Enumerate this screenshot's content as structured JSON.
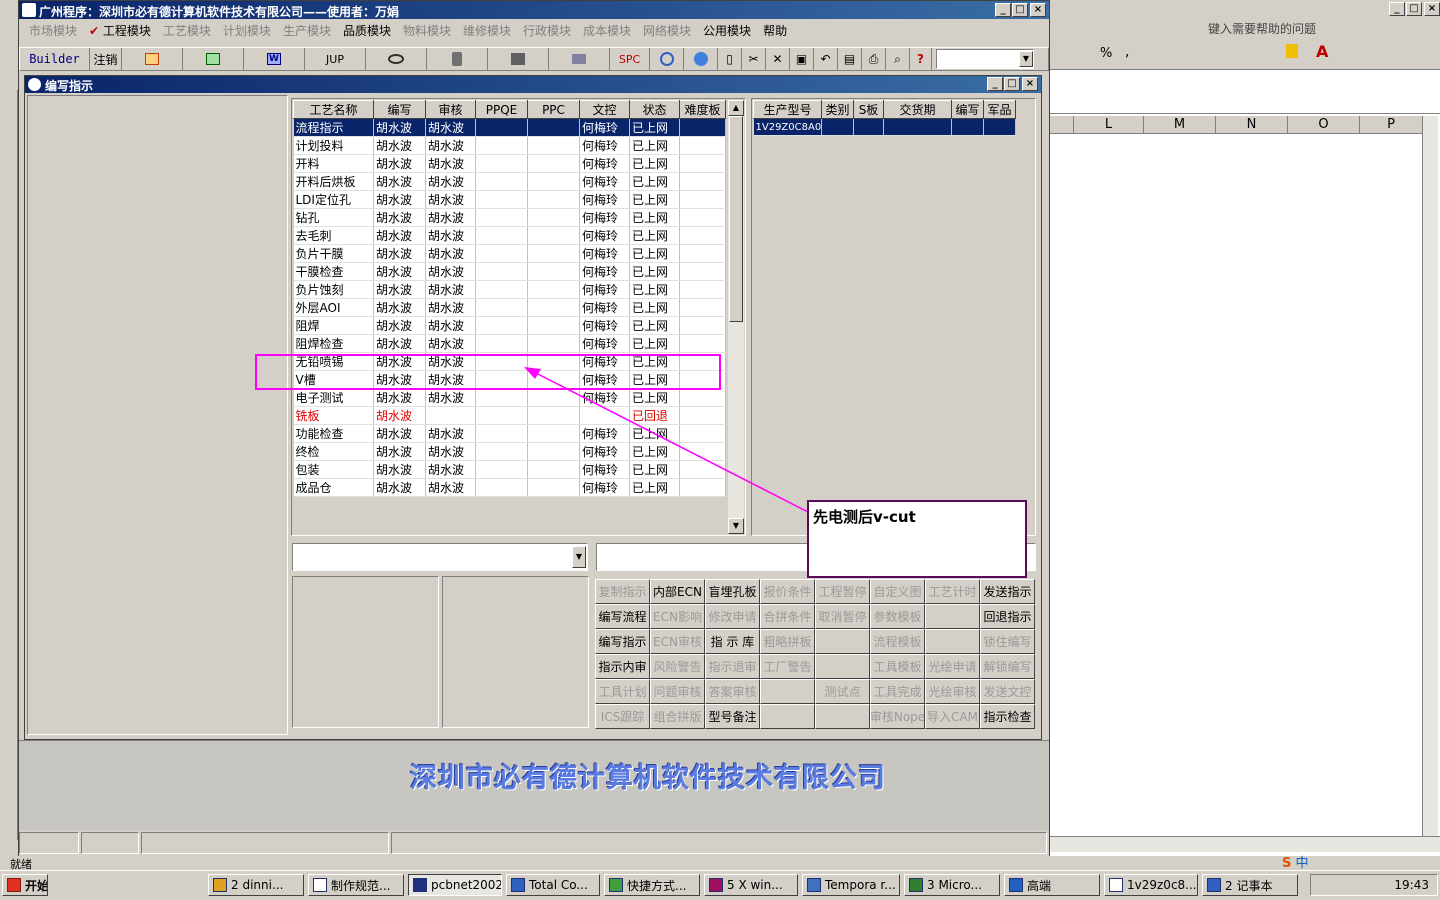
{
  "excel": {
    "help_placeholder": "键入需要帮助的问题",
    "columns": [
      "L",
      "M",
      "N",
      "O",
      "P"
    ]
  },
  "app": {
    "title": "广州程序：深圳市必有德计算机软件技术有限公司——使用者：万娟",
    "menu": [
      {
        "label": "市场模块",
        "enabled": false
      },
      {
        "label": "工程模块",
        "enabled": true,
        "checked": true
      },
      {
        "label": "工艺模块",
        "enabled": false
      },
      {
        "label": "计划模块",
        "enabled": false
      },
      {
        "label": "生产模块",
        "enabled": false
      },
      {
        "label": "品质模块",
        "enabled": true
      },
      {
        "label": "物料模块",
        "enabled": false
      },
      {
        "label": "维修模块",
        "enabled": false
      },
      {
        "label": "行政模块",
        "enabled": false
      },
      {
        "label": "成本模块",
        "enabled": false
      },
      {
        "label": "网络模块",
        "enabled": false
      },
      {
        "label": "公用模块",
        "enabled": true
      },
      {
        "label": "帮助",
        "enabled": true
      }
    ],
    "toolbar": {
      "builder": "Builder",
      "logout": "注销",
      "jup": "JUP",
      "spc": "SPC"
    },
    "company_banner": "深圳市必有德计算机软件技术有限公司",
    "status_ready": "就绪"
  },
  "inner_window": {
    "title": "编写指示",
    "process_grid": {
      "headers": [
        "工艺名称",
        "编写",
        "审核",
        "PPQE",
        "PPC",
        "文控",
        "状态",
        "难度板"
      ],
      "rows": [
        [
          "流程指示",
          "胡水波",
          "胡水波",
          "",
          "",
          "何梅玲",
          "已上网",
          ""
        ],
        [
          "计划投料",
          "胡水波",
          "胡水波",
          "",
          "",
          "何梅玲",
          "已上网",
          ""
        ],
        [
          "开料",
          "胡水波",
          "胡水波",
          "",
          "",
          "何梅玲",
          "已上网",
          ""
        ],
        [
          "开料后烘板",
          "胡水波",
          "胡水波",
          "",
          "",
          "何梅玲",
          "已上网",
          ""
        ],
        [
          "LDI定位孔",
          "胡水波",
          "胡水波",
          "",
          "",
          "何梅玲",
          "已上网",
          ""
        ],
        [
          "钻孔",
          "胡水波",
          "胡水波",
          "",
          "",
          "何梅玲",
          "已上网",
          ""
        ],
        [
          "去毛刺",
          "胡水波",
          "胡水波",
          "",
          "",
          "何梅玲",
          "已上网",
          ""
        ],
        [
          "负片干膜",
          "胡水波",
          "胡水波",
          "",
          "",
          "何梅玲",
          "已上网",
          ""
        ],
        [
          "干膜检查",
          "胡水波",
          "胡水波",
          "",
          "",
          "何梅玲",
          "已上网",
          ""
        ],
        [
          "负片蚀刻",
          "胡水波",
          "胡水波",
          "",
          "",
          "何梅玲",
          "已上网",
          ""
        ],
        [
          "外层AOI",
          "胡水波",
          "胡水波",
          "",
          "",
          "何梅玲",
          "已上网",
          ""
        ],
        [
          "阻焊",
          "胡水波",
          "胡水波",
          "",
          "",
          "何梅玲",
          "已上网",
          ""
        ],
        [
          "阻焊检查",
          "胡水波",
          "胡水波",
          "",
          "",
          "何梅玲",
          "已上网",
          ""
        ],
        [
          "无铅喷锡",
          "胡水波",
          "胡水波",
          "",
          "",
          "何梅玲",
          "已上网",
          ""
        ],
        [
          "V槽",
          "胡水波",
          "胡水波",
          "",
          "",
          "何梅玲",
          "已上网",
          ""
        ],
        [
          "电子测试",
          "胡水波",
          "胡水波",
          "",
          "",
          "何梅玲",
          "已上网",
          ""
        ],
        [
          "铣板",
          "胡水波",
          "",
          "",
          "",
          "",
          "已回退",
          ""
        ],
        [
          "功能检查",
          "胡水波",
          "胡水波",
          "",
          "",
          "何梅玲",
          "已上网",
          ""
        ],
        [
          "终检",
          "胡水波",
          "胡水波",
          "",
          "",
          "何梅玲",
          "已上网",
          ""
        ],
        [
          "包装",
          "胡水波",
          "胡水波",
          "",
          "",
          "何梅玲",
          "已上网",
          ""
        ],
        [
          "成品仓",
          "胡水波",
          "胡水波",
          "",
          "",
          "何梅玲",
          "已上网",
          ""
        ]
      ]
    },
    "model_grid": {
      "headers": [
        "生产型号",
        "类别",
        "S板",
        "交货期",
        "编写",
        "军品"
      ],
      "rows": [
        [
          "1V29Z0C8A0",
          "",
          "",
          "",
          "",
          ""
        ]
      ]
    },
    "buttons": [
      [
        "复制指示",
        "内部ECN",
        "盲埋孔板",
        "报价条件",
        "工程暂停",
        "自定义图",
        "工艺计时",
        "发送指示"
      ],
      [
        "编写流程",
        "ECN影响",
        "修改申请",
        "合拼条件",
        "取消暂停",
        "参数模板",
        "",
        "回退指示"
      ],
      [
        "编写指示",
        "ECN审核",
        "指 示 库",
        "粗略拼板",
        "",
        "流程模板",
        "",
        "锁住编写"
      ],
      [
        "指示内审",
        "风险警告",
        "指示退审",
        "工厂警告",
        "",
        "工具模板",
        "光绘申请",
        "解锁编写"
      ],
      [
        "工具计划",
        "问题审核",
        "答案审核",
        "",
        "测试点",
        "工具完成",
        "光绘审核",
        "发送文控"
      ],
      [
        "ICS跟踪",
        "组合拼版",
        "型号备注",
        "",
        "",
        "审核Nope",
        "导入CAM",
        "指示检查"
      ]
    ],
    "buttons_enabled": [
      [
        false,
        true,
        true,
        false,
        false,
        false,
        false,
        true
      ],
      [
        true,
        false,
        false,
        false,
        false,
        false,
        false,
        true
      ],
      [
        true,
        false,
        true,
        false,
        false,
        false,
        false,
        false
      ],
      [
        true,
        false,
        false,
        false,
        false,
        false,
        false,
        false
      ],
      [
        false,
        false,
        false,
        false,
        false,
        false,
        false,
        false
      ],
      [
        false,
        false,
        true,
        false,
        false,
        false,
        false,
        true
      ]
    ]
  },
  "annotation": {
    "callout_text": "先电测后v-cut",
    "color": "#ff00ff"
  },
  "taskbar": {
    "start": "开始",
    "tasks": [
      "2 dinni...",
      "制作规范...",
      "pcbnet2002",
      "Total Co...",
      "快捷方式...",
      "5 X win...",
      "Tempora r...",
      "3 Micro...",
      "高端",
      "1v29z0c8...",
      "2 记事本"
    ],
    "clock": "19:43",
    "ime": "中"
  }
}
